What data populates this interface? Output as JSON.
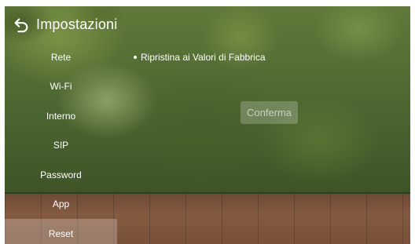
{
  "header": {
    "title": "Impostazioni",
    "back_icon": "back-arrow-icon"
  },
  "sidebar": {
    "items": [
      {
        "label": "Rete"
      },
      {
        "label": "Wi-Fi"
      },
      {
        "label": "Interno"
      },
      {
        "label": "SIP"
      },
      {
        "label": "Password"
      },
      {
        "label": "App"
      },
      {
        "label": "Reset",
        "active": true
      }
    ]
  },
  "main": {
    "option_label": "Ripristina ai Valori di Fabbrica",
    "confirm_label": "Conferma"
  }
}
